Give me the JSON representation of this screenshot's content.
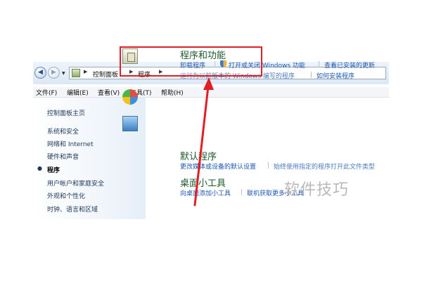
{
  "address_bar": {
    "breadcrumbs": [
      "控制面板",
      "程序"
    ],
    "icons": [
      "back-arrow-icon",
      "forward-arrow-icon",
      "control-panel-icon",
      "chevron-right-icon"
    ]
  },
  "menu": {
    "items": [
      "文件(F)",
      "编辑(E)",
      "查看(V)",
      "工具(T)",
      "帮助(H)"
    ]
  },
  "sidebar": {
    "items": [
      {
        "label": "控制面板主页"
      },
      {
        "label": "系统和安全"
      },
      {
        "label": "网络和 Internet"
      },
      {
        "label": "硬件和声音"
      },
      {
        "label": "程序",
        "current": true
      },
      {
        "label": "用户帐户和家庭安全"
      },
      {
        "label": "外观和个性化"
      },
      {
        "label": "时钟、语言和区域"
      }
    ]
  },
  "categories": [
    {
      "title": "程序和功能",
      "links": [
        "卸载程序",
        "打开或关闭 Windows 功能",
        "查看已安装的更新",
        "运行为以前版本的 Windows 编写的程序",
        "如何安装程序"
      ],
      "highlighted": true
    },
    {
      "title": "默认程序",
      "links": [
        "更改媒体或设备的默认设置",
        "始终使用指定的程序打开此文件类型"
      ]
    },
    {
      "title": "桌面小工具",
      "links": [
        "向桌面添加小工具",
        "联机获取更多小工具"
      ]
    }
  ],
  "watermark": "软件技巧",
  "colors": {
    "highlight": "#e11d25",
    "link": "#1c58b5",
    "category_title": "#1d5a2c"
  }
}
